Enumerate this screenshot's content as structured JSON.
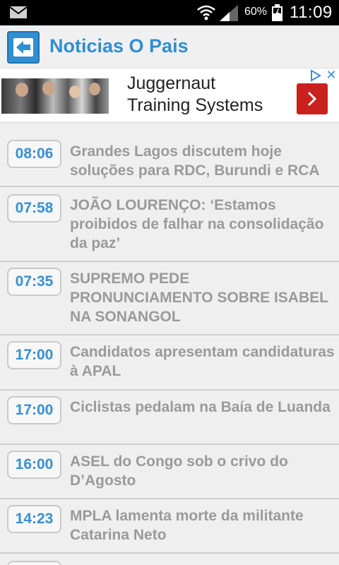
{
  "status_bar": {
    "battery_percent": "60%",
    "time": "11:09"
  },
  "app_bar": {
    "title": "Noticias O Pais"
  },
  "ad": {
    "title_line1": "Juggernaut",
    "title_line2": "Training Systems"
  },
  "news": [
    {
      "time": "08:06",
      "headline": "Grandes Lagos discutem hoje soluções para RDC, Burundi e RCA"
    },
    {
      "time": "07:58",
      "headline": "JOÃO LOURENÇO: ‘Estamos proibidos de falhar na consolidação da paz’"
    },
    {
      "time": "07:35",
      "headline": "SUPREMO PEDE PRONUNCIAMENTO SOBRE ISABEL NA SONANGOL"
    },
    {
      "time": "17:00",
      "headline": "Candidatos apresentam candidaturas à APAL"
    },
    {
      "time": "17:00",
      "headline": "Ciclistas pedalam na Baía de Luanda"
    },
    {
      "time": "16:00",
      "headline": "ASEL do Congo sob o crivo do D’Agosto"
    },
    {
      "time": "14:23",
      "headline": "MPLA lamenta morte da militante Catarina Neto"
    }
  ],
  "colors": {
    "accent": "#2f8fd1",
    "headline_text": "#9a9a9a",
    "ad_button": "#c9211e"
  },
  "icons": [
    "mail-icon",
    "wifi-icon",
    "signal-icon",
    "battery-icon",
    "back-arrow-icon",
    "ad-choices-icon",
    "close-icon",
    "chevron-right-icon"
  ]
}
